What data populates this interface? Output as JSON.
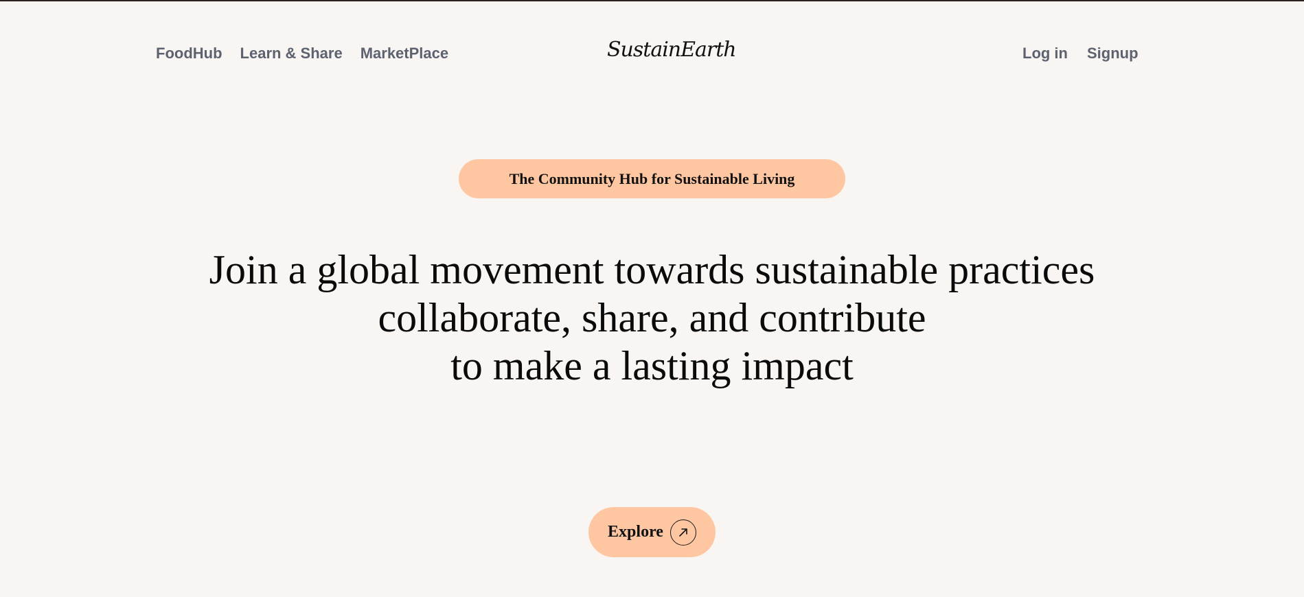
{
  "nav": {
    "left": [
      {
        "label": "FoodHub"
      },
      {
        "label": "Learn & Share"
      },
      {
        "label": "MarketPlace"
      }
    ],
    "logo": "SustainEarth",
    "right": [
      {
        "label": "Log in"
      },
      {
        "label": "Signup"
      }
    ]
  },
  "hero": {
    "badge": "The Community Hub for Sustainable Living",
    "headline": [
      "Join a global movement towards sustainable practices",
      "collaborate, share, and contribute",
      "to make a lasting impact"
    ],
    "cta": {
      "label": "Explore",
      "icon": "arrow-up-right-icon"
    }
  },
  "colors": {
    "background": "#f8f5f2",
    "accent": "#ffc7a1",
    "nav_text": "#5d6270",
    "text": "#0b0b0b"
  }
}
